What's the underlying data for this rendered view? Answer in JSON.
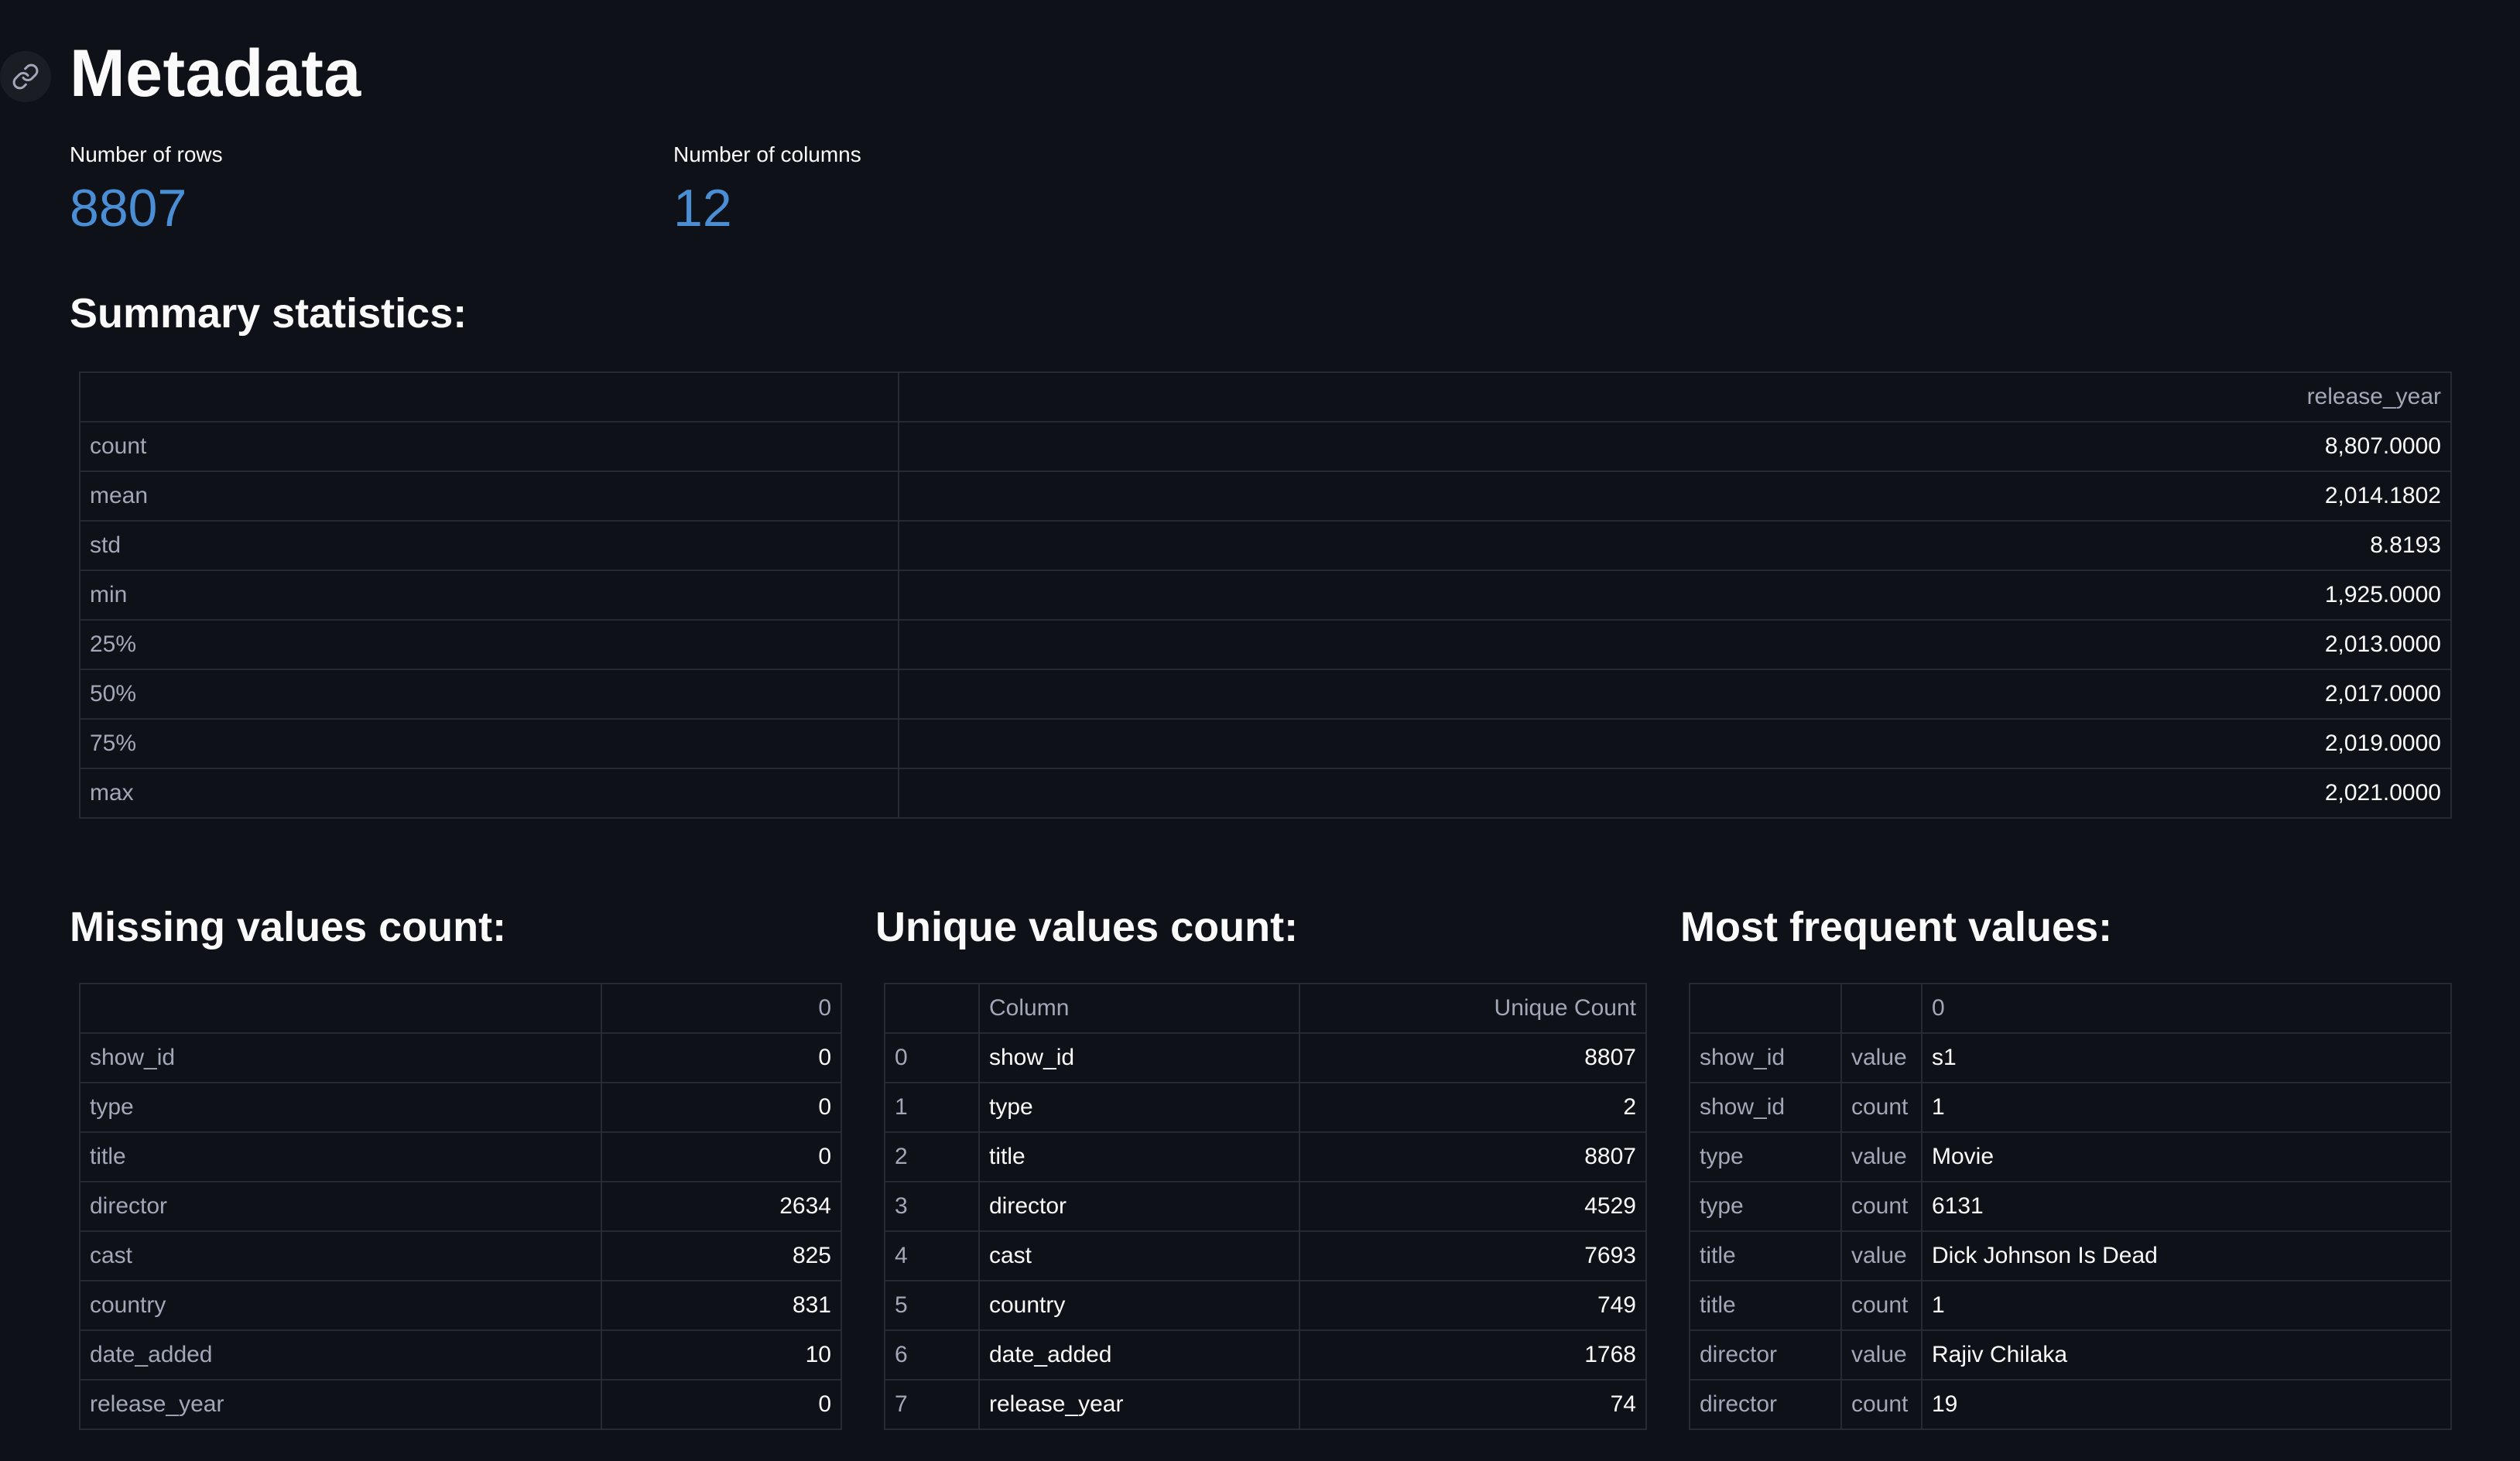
{
  "title": "Metadata",
  "metrics": {
    "rows_label": "Number of rows",
    "rows_value": "8807",
    "cols_label": "Number of columns",
    "cols_value": "12"
  },
  "summary": {
    "heading": "Summary statistics:",
    "column": "release_year",
    "rows": [
      {
        "stat": "count",
        "value": "8,807.0000"
      },
      {
        "stat": "mean",
        "value": "2,014.1802"
      },
      {
        "stat": "std",
        "value": "8.8193"
      },
      {
        "stat": "min",
        "value": "1,925.0000"
      },
      {
        "stat": "25%",
        "value": "2,013.0000"
      },
      {
        "stat": "50%",
        "value": "2,017.0000"
      },
      {
        "stat": "75%",
        "value": "2,019.0000"
      },
      {
        "stat": "max",
        "value": "2,021.0000"
      }
    ]
  },
  "missing": {
    "heading": "Missing values count:",
    "column": "0",
    "rows": [
      {
        "name": "show_id",
        "value": "0"
      },
      {
        "name": "type",
        "value": "0"
      },
      {
        "name": "title",
        "value": "0"
      },
      {
        "name": "director",
        "value": "2634"
      },
      {
        "name": "cast",
        "value": "825"
      },
      {
        "name": "country",
        "value": "831"
      },
      {
        "name": "date_added",
        "value": "10"
      },
      {
        "name": "release_year",
        "value": "0"
      }
    ]
  },
  "unique": {
    "heading": "Unique values count:",
    "col_column": "Column",
    "col_count": "Unique Count",
    "rows": [
      {
        "idx": "0",
        "column": "show_id",
        "count": "8807"
      },
      {
        "idx": "1",
        "column": "type",
        "count": "2"
      },
      {
        "idx": "2",
        "column": "title",
        "count": "8807"
      },
      {
        "idx": "3",
        "column": "director",
        "count": "4529"
      },
      {
        "idx": "4",
        "column": "cast",
        "count": "7693"
      },
      {
        "idx": "5",
        "column": "country",
        "count": "749"
      },
      {
        "idx": "6",
        "column": "date_added",
        "count": "1768"
      },
      {
        "idx": "7",
        "column": "release_year",
        "count": "74"
      }
    ]
  },
  "frequent": {
    "heading": "Most frequent values:",
    "column": "0",
    "rows": [
      {
        "field": "show_id",
        "kind": "value",
        "value": "s1"
      },
      {
        "field": "show_id",
        "kind": "count",
        "value": "1"
      },
      {
        "field": "type",
        "kind": "value",
        "value": "Movie"
      },
      {
        "field": "type",
        "kind": "count",
        "value": "6131"
      },
      {
        "field": "title",
        "kind": "value",
        "value": "Dick Johnson Is Dead"
      },
      {
        "field": "title",
        "kind": "count",
        "value": "1"
      },
      {
        "field": "director",
        "kind": "value",
        "value": "Rajiv Chilaka"
      },
      {
        "field": "director",
        "kind": "count",
        "value": "19"
      }
    ]
  }
}
